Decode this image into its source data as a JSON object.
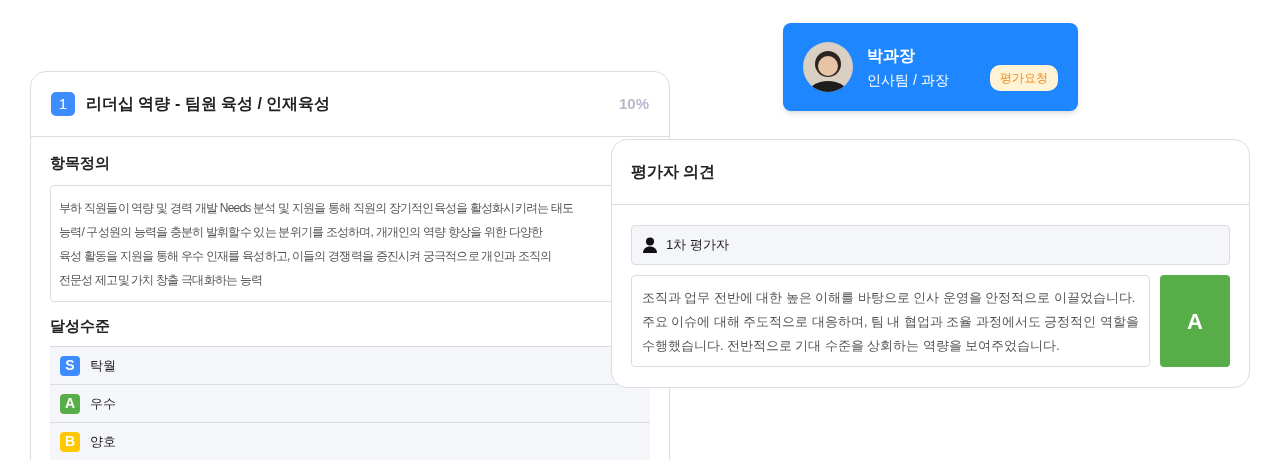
{
  "criterion": {
    "number": "1",
    "title": "리더십 역량 - 팀원 육성 / 인재육성",
    "weight": "10%"
  },
  "definition": {
    "heading": "항목정의",
    "lines": [
      "부하 직원들이 역량 및 경력 개발 Needs 분석 및 지원을 통해 직원의 장기적인육성을 활성화시키려는 태도",
      "능력/ 구성원의 능력을 충분히 발휘할수 있는 분위기를 조성하며, 개개인의 역량 향상을 위한 다양한",
      "육성 활동을 지원을 통해 우수 인재를 육성하고, 이들의 경쟁력을 증진시켜 궁극적으로 개인과 조직의",
      "전문성 제고및 가치 창출 극대화하는 능력"
    ]
  },
  "achievement": {
    "heading": "달성수준",
    "levels": [
      {
        "grade": "S",
        "label": "탁월",
        "color": "#3d8bfd"
      },
      {
        "grade": "A",
        "label": "우수",
        "color": "#57ae48"
      },
      {
        "grade": "B",
        "label": "양호",
        "color": "#ffc800"
      }
    ]
  },
  "profile": {
    "name": "박과장",
    "role": "인사팀 / 과장",
    "badge": "평가요청"
  },
  "opinion": {
    "title": "평가자 의견",
    "evaluator": "1차 평가자",
    "comment_lines": [
      "조직과 업무 전반에 대한 높은 이해를 바탕으로 인사 운영을 안정적으로 이끌었습니다.",
      "주요 이슈에 대해 주도적으로 대응하며, 팀 내 협업과 조율 과정에서도 긍정적인 역할을",
      "수행했습니다. 전반적으로 기대 수준을 상회하는 역량을 보여주었습니다."
    ],
    "grade": "A"
  }
}
